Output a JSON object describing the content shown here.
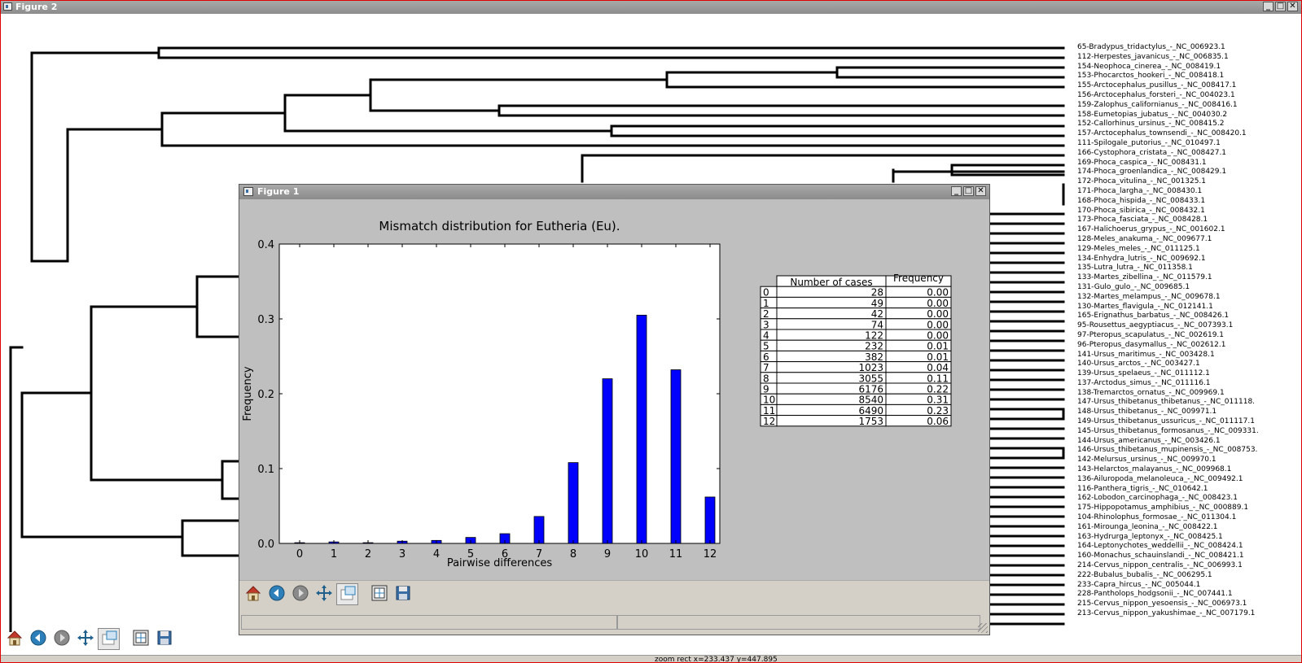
{
  "window_back": {
    "title": "Figure 2",
    "buttons": {
      "minimize": "_",
      "maximize": "□",
      "close": "✕"
    }
  },
  "tree": {
    "leaves": [
      "65-Bradypus_tridactylus_-_NC_006923.1",
      "112-Herpestes_javanicus_-_NC_006835.1",
      "154-Neophoca_cinerea_-_NC_008419.1",
      "153-Phocarctos_hookeri_-_NC_008418.1",
      "155-Arctocephalus_pusillus_-_NC_008417.1",
      "156-Arctocephalus_forsteri_-_NC_004023.1",
      "159-Zalophus_californianus_-_NC_008416.1",
      "158-Eumetopias_jubatus_-_NC_004030.2",
      "152-Callorhinus_ursinus_-_NC_008415.2",
      "157-Arctocephalus_townsendi_-_NC_008420.1",
      "111-Spilogale_putorius_-_NC_010497.1",
      "166-Cystophora_cristata_-_NC_008427.1",
      "169-Phoca_caspica_-_NC_008431.1",
      "174-Phoca_groenlandica_-_NC_008429.1",
      "172-Phoca_vitulina_-_NC_001325.1",
      "171-Phoca_largha_-_NC_008430.1",
      "168-Phoca_hispida_-_NC_008433.1",
      "170-Phoca_sibirica_-_NC_008432.1",
      "173-Phoca_fasciata_-_NC_008428.1",
      "167-Halichoerus_grypus_-_NC_001602.1",
      "128-Meles_anakuma_-_NC_009677.1",
      "129-Meles_meles_-_NC_011125.1",
      "134-Enhydra_lutris_-_NC_009692.1",
      "135-Lutra_lutra_-_NC_011358.1",
      "133-Martes_zibellina_-_NC_011579.1",
      "131-Gulo_gulo_-_NC_009685.1",
      "132-Martes_melampus_-_NC_009678.1",
      "130-Martes_flavigula_-_NC_012141.1",
      "165-Erignathus_barbatus_-_NC_008426.1",
      "95-Rousettus_aegyptiacus_-_NC_007393.1",
      "97-Pteropus_scapulatus_-_NC_002619.1",
      "96-Pteropus_dasymallus_-_NC_002612.1",
      "141-Ursus_maritimus_-_NC_003428.1",
      "140-Ursus_arctos_-_NC_003427.1",
      "139-Ursus_spelaeus_-_NC_011112.1",
      "137-Arctodus_simus_-_NC_011116.1",
      "138-Tremarctos_ornatus_-_NC_009969.1",
      "147-Ursus_thibetanus_thibetanus_-_NC_011118.",
      "148-Ursus_thibetanus_-_NC_009971.1",
      "149-Ursus_thibetanus_ussuricus_-_NC_011117.1",
      "145-Ursus_thibetanus_formosanus_-_NC_009331.",
      "144-Ursus_americanus_-_NC_003426.1",
      "146-Ursus_thibetanus_mupinensis_-_NC_008753.",
      "142-Melursus_ursinus_-_NC_009970.1",
      "143-Helarctos_malayanus_-_NC_009968.1",
      "136-Ailuropoda_melanoleuca_-_NC_009492.1",
      "116-Panthera_tigris_-_NC_010642.1",
      "162-Lobodon_carcinophaga_-_NC_008423.1",
      "175-Hippopotamus_amphibius_-_NC_000889.1",
      "104-Rhinolophus_formosae_-_NC_011304.1",
      "161-Mirounga_leonina_-_NC_008422.1",
      "163-Hydrurga_leptonyx_-_NC_008425.1",
      "164-Leptonychotes_weddellii_-_NC_008424.1",
      "160-Monachus_schauinslandi_-_NC_008421.1",
      "214-Cervus_nippon_centralis_-_NC_006993.1",
      "222-Bubalus_bubalis_-_NC_006295.1",
      "233-Capra_hircus_-_NC_005044.1",
      "228-Pantholops_hodgsonii_-_NC_007441.1",
      "215-Cervus_nippon_yesoensis_-_NC_006973.1",
      "213-Cervus_nippon_yakushimae_-_NC_007179.1"
    ]
  },
  "toolbar_back": {
    "buttons": [
      "home-icon",
      "back-icon",
      "forward-icon",
      "pan-icon",
      "zoom-icon",
      "subplots-icon",
      "save-icon"
    ]
  },
  "status_back": {
    "coords": "zoom rect  x=233.437     y=447.895"
  },
  "window_front": {
    "title": "Figure 1",
    "buttons": {
      "minimize": "_",
      "maximize": "□",
      "close": "✕"
    }
  },
  "table": {
    "headers": [
      "Number of cases",
      "Frequency"
    ],
    "rows": [
      {
        "idx": "0",
        "cases": "28",
        "freq": "0.00"
      },
      {
        "idx": "1",
        "cases": "49",
        "freq": "0.00"
      },
      {
        "idx": "2",
        "cases": "42",
        "freq": "0.00"
      },
      {
        "idx": "3",
        "cases": "74",
        "freq": "0.00"
      },
      {
        "idx": "4",
        "cases": "122",
        "freq": "0.00"
      },
      {
        "idx": "5",
        "cases": "232",
        "freq": "0.01"
      },
      {
        "idx": "6",
        "cases": "382",
        "freq": "0.01"
      },
      {
        "idx": "7",
        "cases": "1023",
        "freq": "0.04"
      },
      {
        "idx": "8",
        "cases": "3055",
        "freq": "0.11"
      },
      {
        "idx": "9",
        "cases": "6176",
        "freq": "0.22"
      },
      {
        "idx": "10",
        "cases": "8540",
        "freq": "0.31"
      },
      {
        "idx": "11",
        "cases": "6490",
        "freq": "0.23"
      },
      {
        "idx": "12",
        "cases": "1753",
        "freq": "0.06"
      }
    ]
  },
  "chart_data": {
    "type": "bar",
    "title": "Mismatch distribution for Eutheria (Eu).",
    "xlabel": "Pairwise differences",
    "ylabel": "Frequency",
    "categories": [
      "0",
      "1",
      "2",
      "3",
      "4",
      "5",
      "6",
      "7",
      "8",
      "9",
      "10",
      "11",
      "12"
    ],
    "values": [
      0.001,
      0.002,
      0.001,
      0.003,
      0.004,
      0.008,
      0.013,
      0.036,
      0.108,
      0.22,
      0.305,
      0.232,
      0.062
    ],
    "ylim": [
      0,
      0.4
    ],
    "yticks": [
      "0.0",
      "0.1",
      "0.2",
      "0.3",
      "0.4"
    ],
    "bar_color": "#0000ff",
    "grid": false
  },
  "toolbar_front": {
    "buttons": [
      "home-icon",
      "back-icon",
      "forward-icon",
      "pan-icon",
      "zoom-icon",
      "subplots-icon",
      "save-icon"
    ]
  }
}
